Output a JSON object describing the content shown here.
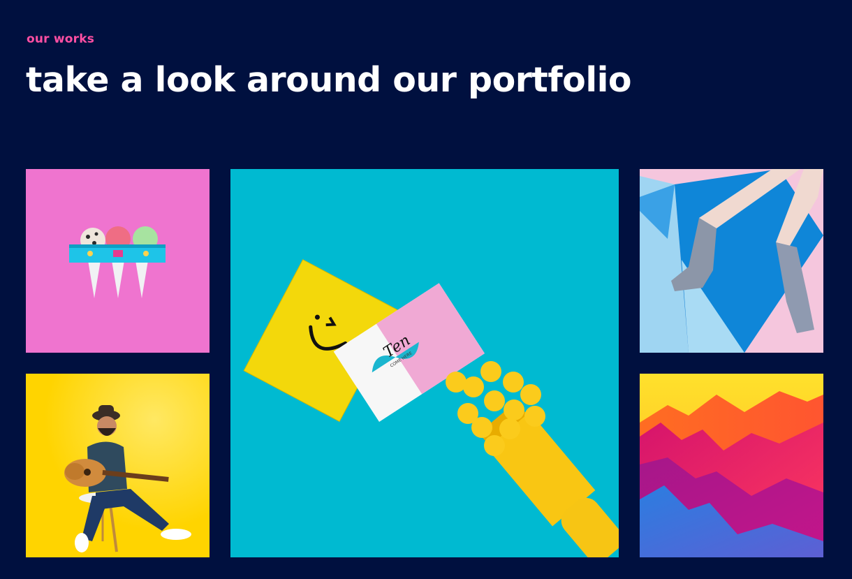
{
  "section": {
    "eyebrow": "our works",
    "title": "take a look around our portfolio"
  },
  "colors": {
    "background": "#00103f",
    "accent": "#ff4fa3",
    "title": "#ffffff"
  },
  "portfolio": {
    "items": [
      {
        "image": "ice-cream-cones-photo",
        "background": "#ef74cf"
      },
      {
        "image": "business-cards-paintbrush-photo",
        "background": "#00bad1"
      },
      {
        "image": "legs-socks-photo",
        "background": "#f5c6dd"
      },
      {
        "image": "man-guitar-photo",
        "background": "#ffd400"
      },
      {
        "image": "abstract-gradient-mountains-photo",
        "background": "#e23a7c"
      }
    ],
    "card_text": {
      "brand": "Ten",
      "tagline": "COME HERE"
    }
  }
}
